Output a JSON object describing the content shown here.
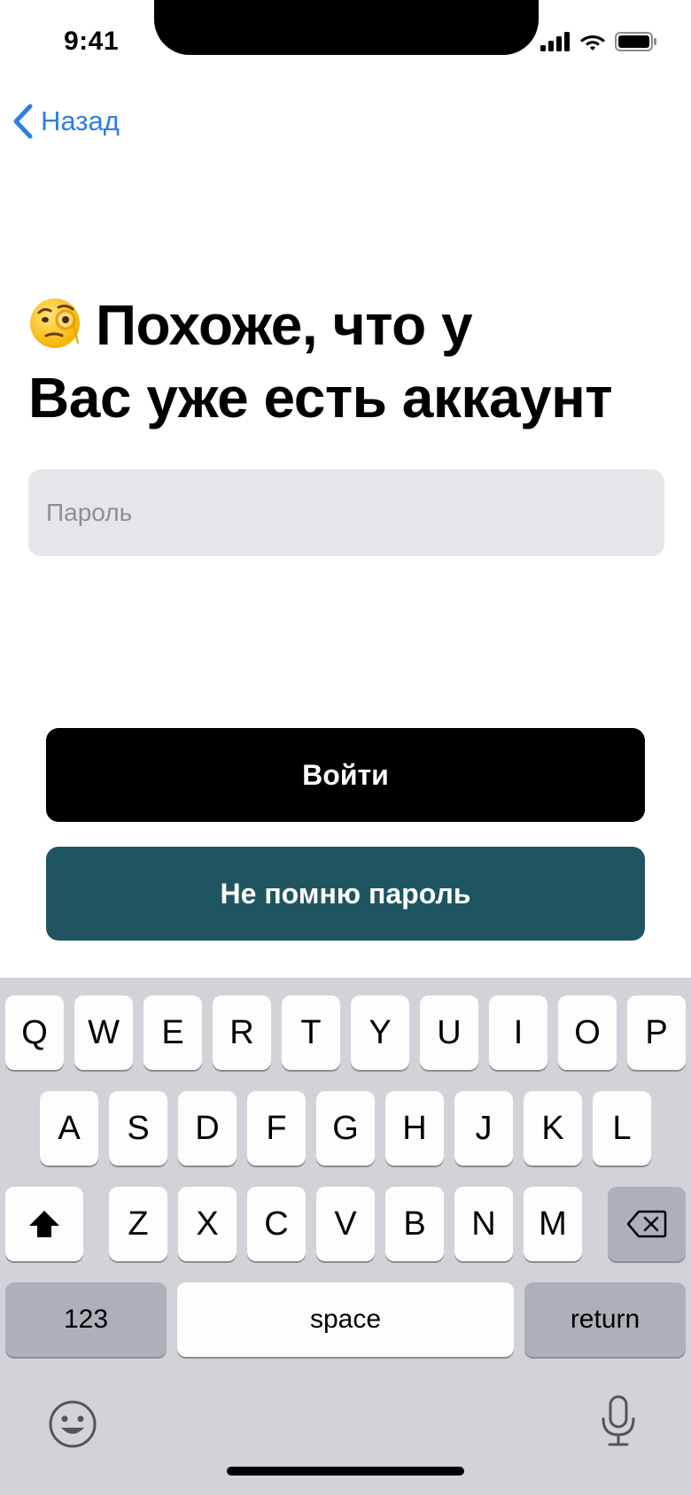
{
  "status_bar": {
    "time": "9:41"
  },
  "nav": {
    "back_label": "Назад"
  },
  "heading": {
    "emoji": "face-with-monocle",
    "line1": "Похоже, что у",
    "line2": "Вас уже есть аккаунт"
  },
  "password": {
    "placeholder": "Пароль",
    "value": ""
  },
  "buttons": {
    "login": "Войти",
    "forgot": "Не помню пароль"
  },
  "colors": {
    "accent_link": "#2f7fe0",
    "login_button": "#000000",
    "forgot_button": "#1e5560",
    "input_bg": "#e5e5ea",
    "keyboard_bg": "#d1d3d9"
  },
  "keyboard": {
    "row1": [
      "Q",
      "W",
      "E",
      "R",
      "T",
      "Y",
      "U",
      "I",
      "O",
      "P"
    ],
    "row2": [
      "A",
      "S",
      "D",
      "F",
      "G",
      "H",
      "J",
      "K",
      "L"
    ],
    "row3": [
      "Z",
      "X",
      "C",
      "V",
      "B",
      "N",
      "M"
    ],
    "numbers_label": "123",
    "space_label": "space",
    "return_label": "return",
    "icons": {
      "shift": "shift-icon",
      "delete": "backspace-icon",
      "emoji": "emoji-icon",
      "dictation": "microphone-icon"
    }
  }
}
